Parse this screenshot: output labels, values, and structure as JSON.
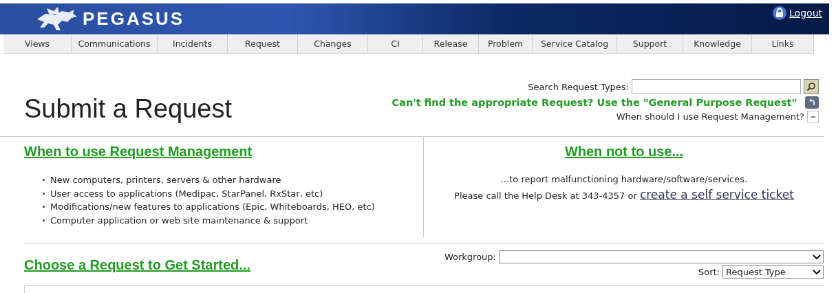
{
  "header": {
    "brand": "PEGASUS",
    "logout": "Logout"
  },
  "nav": [
    {
      "label": "Views",
      "selected": false
    },
    {
      "label": "Communications",
      "selected": false
    },
    {
      "label": "Incidents",
      "selected": false
    },
    {
      "label": "Request",
      "selected": false
    },
    {
      "label": "Changes",
      "selected": false
    },
    {
      "label": "CI",
      "selected": false
    },
    {
      "label": "Release",
      "selected": false
    },
    {
      "label": "Problem",
      "selected": false
    },
    {
      "label": "Service Catalog",
      "selected": false
    },
    {
      "label": "Support",
      "selected": false
    },
    {
      "label": "Knowledge",
      "selected": false
    },
    {
      "label": "Links",
      "selected": false
    }
  ],
  "page_title": "Submit a Request",
  "search": {
    "label": "Search Request Types:"
  },
  "general_purpose": "Can't find the appropriate Request? Use the \"General Purpose Request\"",
  "help_toggle": {
    "label": "When should I use Request Management?",
    "expanded": true
  },
  "when_to_use": {
    "heading": "When to use Request Management",
    "items": [
      "New computers, printers, servers & other hardware",
      "User access to applications (Medipac, StarPanel, RxStar, etc)",
      "Modifications/new features to applications (Epic, Whiteboards, HEO, etc)",
      "Computer application or web site maintenance & support"
    ]
  },
  "when_not_to_use": {
    "heading": "When not to use...",
    "line_1": "...to report malfunctioning hardware/software/services.",
    "line_2": "Please call the Help Desk at 343-4357 or",
    "link": "create a self service ticket"
  },
  "choose": {
    "heading": "Choose a Request to Get Started...",
    "workgroup_label": "Workgroup:",
    "sort_label": "Sort:",
    "sort_value": "Request Type"
  }
}
